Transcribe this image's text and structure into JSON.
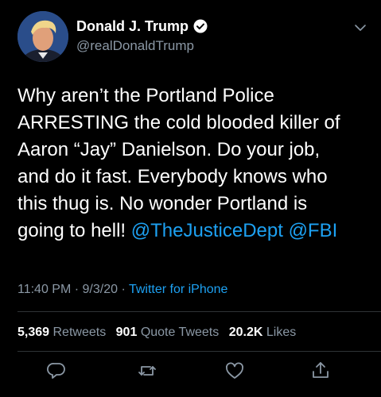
{
  "author": {
    "display_name": "Donald J. Trump",
    "handle": "@realDonaldTrump",
    "verified_icon": "verified-badge-icon"
  },
  "tweet": {
    "text_lines": [
      "Why aren’t the Portland Police",
      "ARRESTING the cold blooded killer of",
      "Aaron “Jay” Danielson. Do your job,",
      "and do it fast. Everybody knows who",
      "this thug is. No wonder Portland is",
      "going to hell!"
    ],
    "mention_1": "@TheJusticeDept",
    "mention_2": "@FBI"
  },
  "meta": {
    "time": "11:40 PM",
    "sep1": " · ",
    "date": "9/3/20",
    "sep2": " · ",
    "source": "Twitter for iPhone"
  },
  "stats": {
    "retweets_count": "5,369",
    "retweets_label": "Retweets",
    "quote_count": "901",
    "quote_label": "Quote Tweets",
    "likes_count": "20.2K",
    "likes_label": "Likes"
  },
  "colors": {
    "background": "#000000",
    "text": "#ffffff",
    "secondary": "#8b98a5",
    "accent": "#1da1f2",
    "divider": "#2f3336"
  },
  "actions": [
    "reply-icon",
    "retweet-icon",
    "like-icon",
    "share-icon"
  ]
}
